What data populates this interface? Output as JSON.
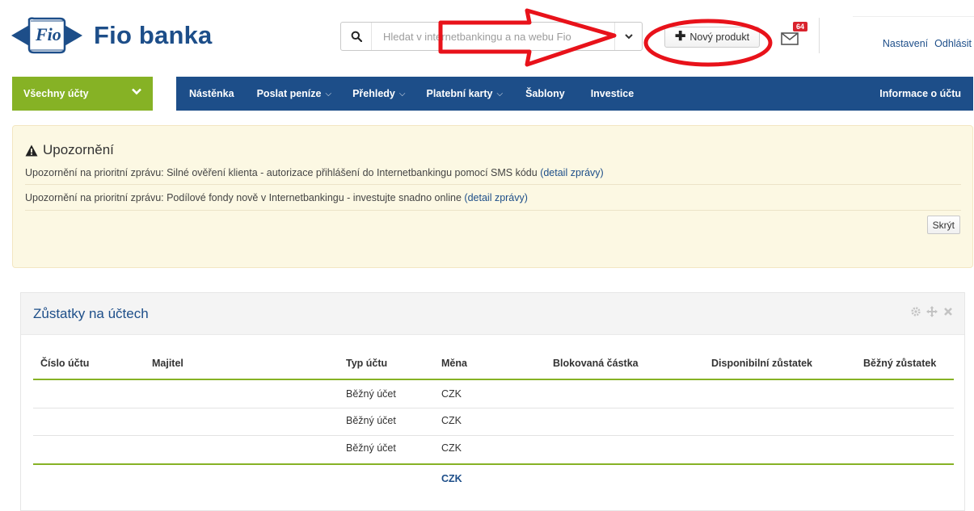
{
  "header": {
    "brand_name": "Fio banka",
    "logo_text": "Fio",
    "search_placeholder": "Hledat v internetbankingu a na webu Fio",
    "new_product_label": "Nový produkt",
    "mail_badge": "64",
    "settings_link": "Nastavení",
    "logout_link": "Odhlásit"
  },
  "nav": {
    "accounts_selector": "Všechny účty",
    "items": [
      {
        "label": "Nástěnka",
        "dropdown": false
      },
      {
        "label": "Poslat peníze",
        "dropdown": true
      },
      {
        "label": "Přehledy",
        "dropdown": true
      },
      {
        "label": "Platební karty",
        "dropdown": true
      },
      {
        "label": "Šablony",
        "dropdown": false
      },
      {
        "label": "Investice",
        "dropdown": false
      }
    ],
    "account_info": "Informace o účtu"
  },
  "alert": {
    "title": "Upozornění",
    "messages": [
      {
        "text": "Upozornění na prioritní zprávu: Silné ověření klienta - autorizace přihlášení do Internetbankingu pomocí SMS kódu",
        "link": "(detail zprávy)"
      },
      {
        "text": "Upozornění na prioritní zprávu: Podílové fondy nově v Internetbankingu - investujte snadno online",
        "link": "(detail zprávy)"
      }
    ],
    "hide_button": "Skrýt"
  },
  "balances": {
    "title": "Zůstatky na účtech",
    "columns": [
      "Číslo účtu",
      "Majitel",
      "Typ účtu",
      "Měna",
      "Blokovaná částka",
      "Disponibilní zůstatek",
      "Běžný zůstatek"
    ],
    "rows": [
      {
        "type": "Běžný účet",
        "currency": "CZK"
      },
      {
        "type": "Běžný účet",
        "currency": "CZK"
      },
      {
        "type": "Běžný účet",
        "currency": "CZK"
      }
    ],
    "total_currency": "CZK"
  },
  "colors": {
    "brand_blue": "#1d4e89",
    "brand_green": "#86b225",
    "alert_bg": "#fcf8e3",
    "badge_red": "#d9232d",
    "annotation_red": "#e8121a"
  },
  "icons": [
    "fio-logo-icon",
    "search-icon",
    "chevron-down-icon",
    "plus-icon",
    "mail-icon",
    "warning-icon",
    "gear-icon",
    "move-icon",
    "close-icon"
  ]
}
